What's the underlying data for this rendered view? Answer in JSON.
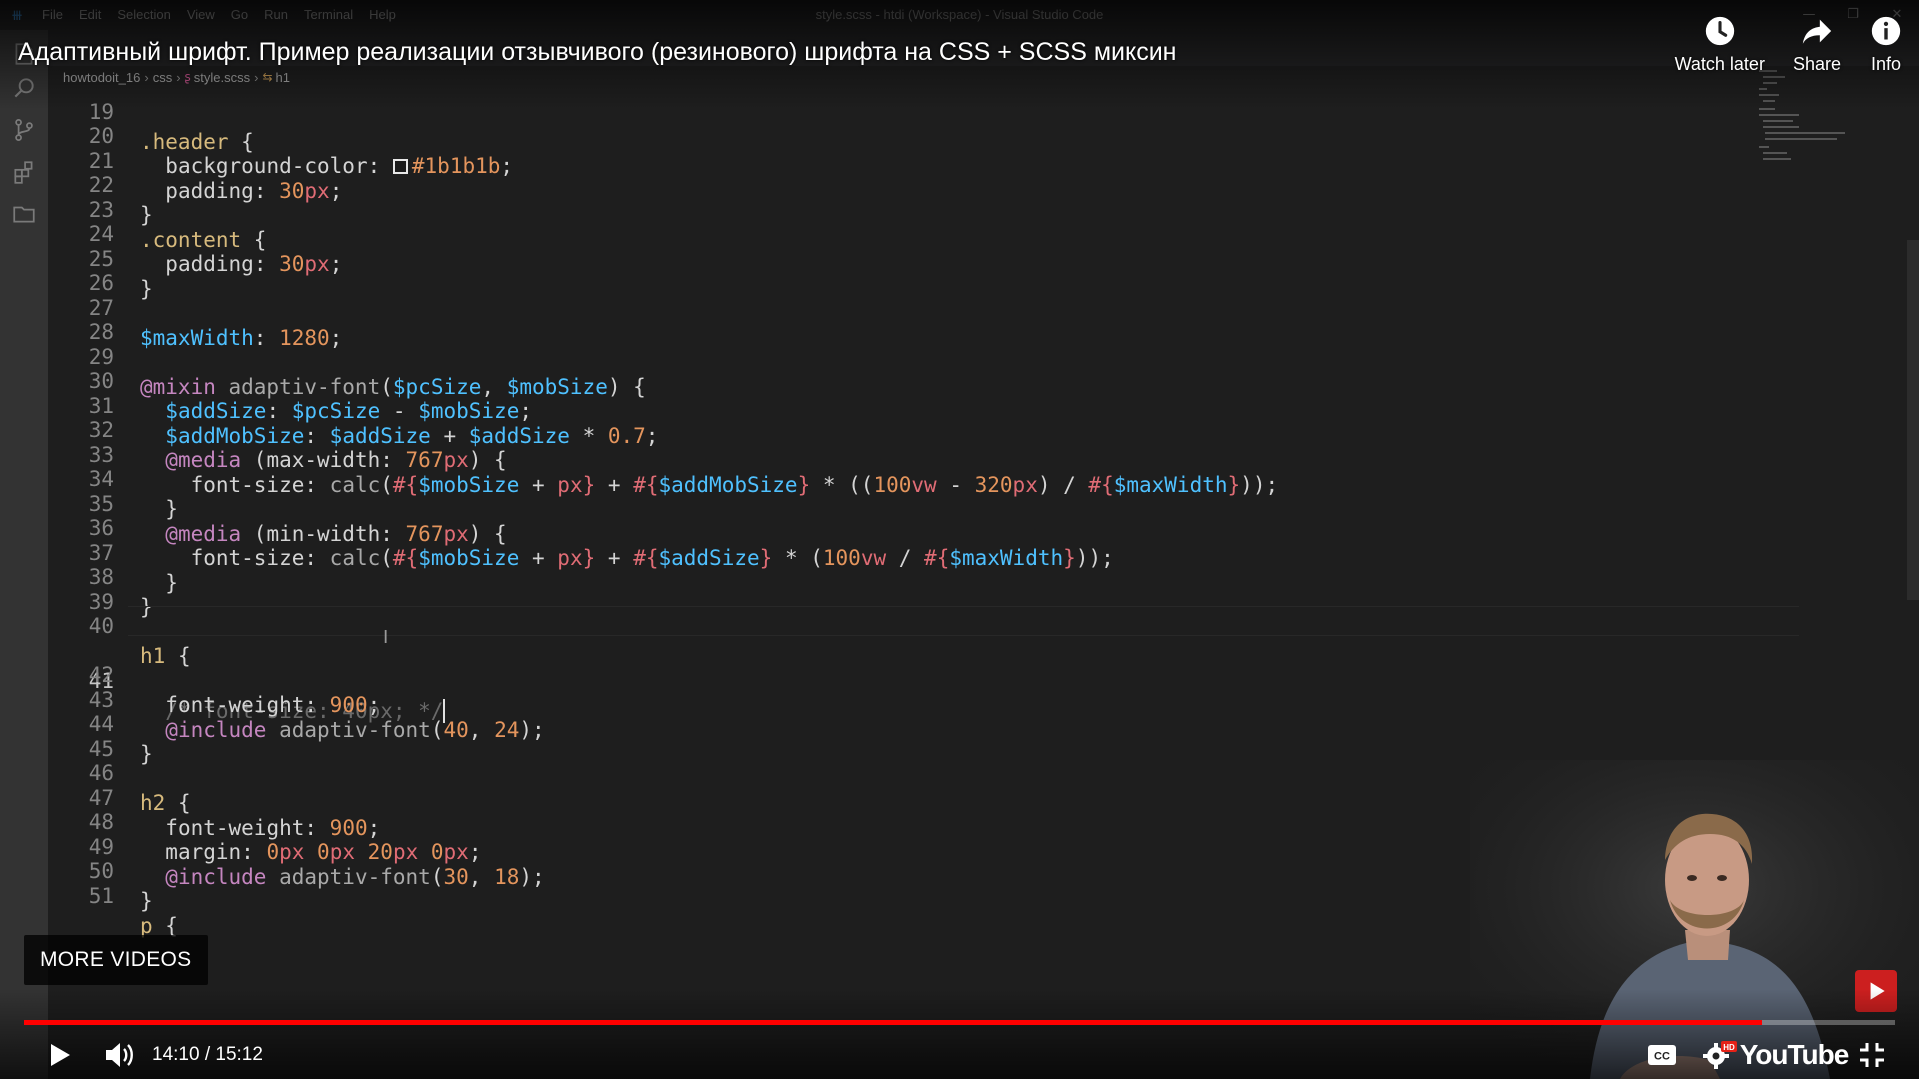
{
  "vscode": {
    "window_title": "style.scss - htdi (Workspace) - Visual Studio Code",
    "menu": [
      "File",
      "Edit",
      "Selection",
      "View",
      "Go",
      "Run",
      "Terminal",
      "Help"
    ],
    "window_controls": [
      "—",
      "❐",
      "✕"
    ],
    "breadcrumbs": [
      "howtodoit_16",
      "css",
      "style.scss",
      "h1"
    ],
    "current_line": 41
  },
  "code_lines": [
    {
      "n": "19"
    },
    {
      "n": "20"
    },
    {
      "n": "21"
    },
    {
      "n": "22"
    },
    {
      "n": "23"
    },
    {
      "n": "24"
    },
    {
      "n": "25"
    },
    {
      "n": "26"
    },
    {
      "n": "27"
    },
    {
      "n": "28"
    },
    {
      "n": "29"
    },
    {
      "n": "30"
    },
    {
      "n": "31"
    },
    {
      "n": "32"
    },
    {
      "n": "33"
    },
    {
      "n": "34"
    },
    {
      "n": "35"
    },
    {
      "n": "36"
    },
    {
      "n": "37"
    },
    {
      "n": "38"
    },
    {
      "n": "39"
    },
    {
      "n": "40"
    },
    {
      "n": "41"
    },
    {
      "n": "42"
    },
    {
      "n": "43"
    },
    {
      "n": "44"
    },
    {
      "n": "45"
    },
    {
      "n": "46"
    },
    {
      "n": "47"
    },
    {
      "n": "48"
    },
    {
      "n": "49"
    },
    {
      "n": "50"
    },
    {
      "n": "51"
    }
  ],
  "code": {
    "l19": {
      "sel": ".header",
      "brace": " {"
    },
    "l20": {
      "prop": "background-color",
      "colon": ": ",
      "hex": "#1b1b1b",
      "semi": ";"
    },
    "l21": {
      "prop": "padding",
      "colon": ": ",
      "num": "30",
      "unit": "px",
      "semi": ";"
    },
    "l22": {
      "brace": "}"
    },
    "l23": {
      "sel": ".content",
      "brace": " {"
    },
    "l24": {
      "prop": "padding",
      "colon": ": ",
      "num": "30",
      "unit": "px",
      "semi": ";"
    },
    "l25": {
      "brace": "}"
    },
    "l27": {
      "var": "$maxWidth",
      "colon": ": ",
      "num": "1280",
      "semi": ";"
    },
    "l29": {
      "at": "@mixin",
      "fn": " adaptiv-font",
      "open": "(",
      "v1": "$pcSize",
      "comma": ", ",
      "v2": "$mobSize",
      "close": ") {"
    },
    "l30": {
      "v1": "$addSize",
      "colon": ": ",
      "v2": "$pcSize",
      "op": " - ",
      "v3": "$mobSize",
      "semi": ";"
    },
    "l31": {
      "v1": "$addMobSize",
      "colon": ": ",
      "v2": "$addSize",
      "op": " + ",
      "v3": "$addSize",
      "op2": " * ",
      "num": "0.7",
      "semi": ";"
    },
    "l32": {
      "at": "@media",
      "p1": " (max-width: ",
      "num": "767",
      "unit": "px",
      "p2": ") {"
    },
    "l33": {
      "prop": "font-size",
      "colon": ": ",
      "fn": "calc",
      "p1": "(",
      "i1": "#{",
      "v1": "$mobSize",
      "p2": " + ",
      "u1": "px",
      "i2": "}",
      "p3": " + ",
      "i3": "#{",
      "v2": "$addMobSize",
      "i4": "}",
      "p4": " * ((",
      "n1": "100",
      "u2": "vw",
      "p5": " - ",
      "n2": "320",
      "u3": "px",
      "p6": ") / ",
      "i5": "#{",
      "v3": "$maxWidth",
      "i6": "}",
      "p7": "));"
    },
    "l34": {
      "brace": "}"
    },
    "l35": {
      "at": "@media",
      "p1": " (min-width: ",
      "num": "767",
      "unit": "px",
      "p2": ") {"
    },
    "l36": {
      "prop": "font-size",
      "colon": ": ",
      "fn": "calc",
      "p1": "(",
      "i1": "#{",
      "v1": "$mobSize",
      "p2": " + ",
      "u1": "px",
      "i2": "}",
      "p3": " + ",
      "i3": "#{",
      "v2": "$addSize",
      "i4": "}",
      "p4": " * (",
      "n1": "100",
      "u2": "vw",
      "p5": " / ",
      "i5": "#{",
      "v3": "$maxWidth",
      "i6": "}",
      "p6": "));"
    },
    "l37": {
      "brace": "}"
    },
    "l38": {
      "brace": "}"
    },
    "l40": {
      "sel": "h1",
      "brace": " {"
    },
    "l41": {
      "cmt": "/* font-size: 40px; */"
    },
    "l42": {
      "prop": "font-weight",
      "colon": ": ",
      "num": "900",
      "semi": ";"
    },
    "l43": {
      "at": "@include",
      "fn": " adaptiv-font",
      "p1": "(",
      "n1": "40",
      "comma": ", ",
      "n2": "24",
      "p2": ");"
    },
    "l44": {
      "brace": "}"
    },
    "l46": {
      "sel": "h2",
      "brace": " {"
    },
    "l47": {
      "prop": "font-weight",
      "colon": ": ",
      "num": "900",
      "semi": ";"
    },
    "l48": {
      "prop": "margin",
      "colon": ": ",
      "n1": "0",
      "u1": "px ",
      "n2": "0",
      "u2": "px ",
      "n3": "20",
      "u3": "px ",
      "n4": "0",
      "u4": "px",
      "semi": ";"
    },
    "l49": {
      "at": "@include",
      "fn": " adaptiv-font",
      "p1": "(",
      "n1": "30",
      "comma": ", ",
      "n2": "18",
      "p2": ");"
    },
    "l50": {
      "brace": "}"
    },
    "l51": {
      "sel": "p",
      "brace": " {"
    }
  },
  "youtube": {
    "title": "Адаптивный шрифт. Пример реализации отзывчивого (резинового) шрифта на CSS + SCSS миксин",
    "actions": [
      {
        "label": "Watch later",
        "icon": "clock-icon"
      },
      {
        "label": "Share",
        "icon": "share-arrow-icon"
      },
      {
        "label": "Info",
        "icon": "info-icon"
      }
    ],
    "more_videos": "MORE VIDEOS",
    "time": "14:10 / 15:12",
    "progress": 0.9288,
    "buffered": 0.9,
    "logo": "YouTube",
    "colors": {
      "progress": "#ff0000",
      "badge": "#cc1f1f"
    }
  }
}
